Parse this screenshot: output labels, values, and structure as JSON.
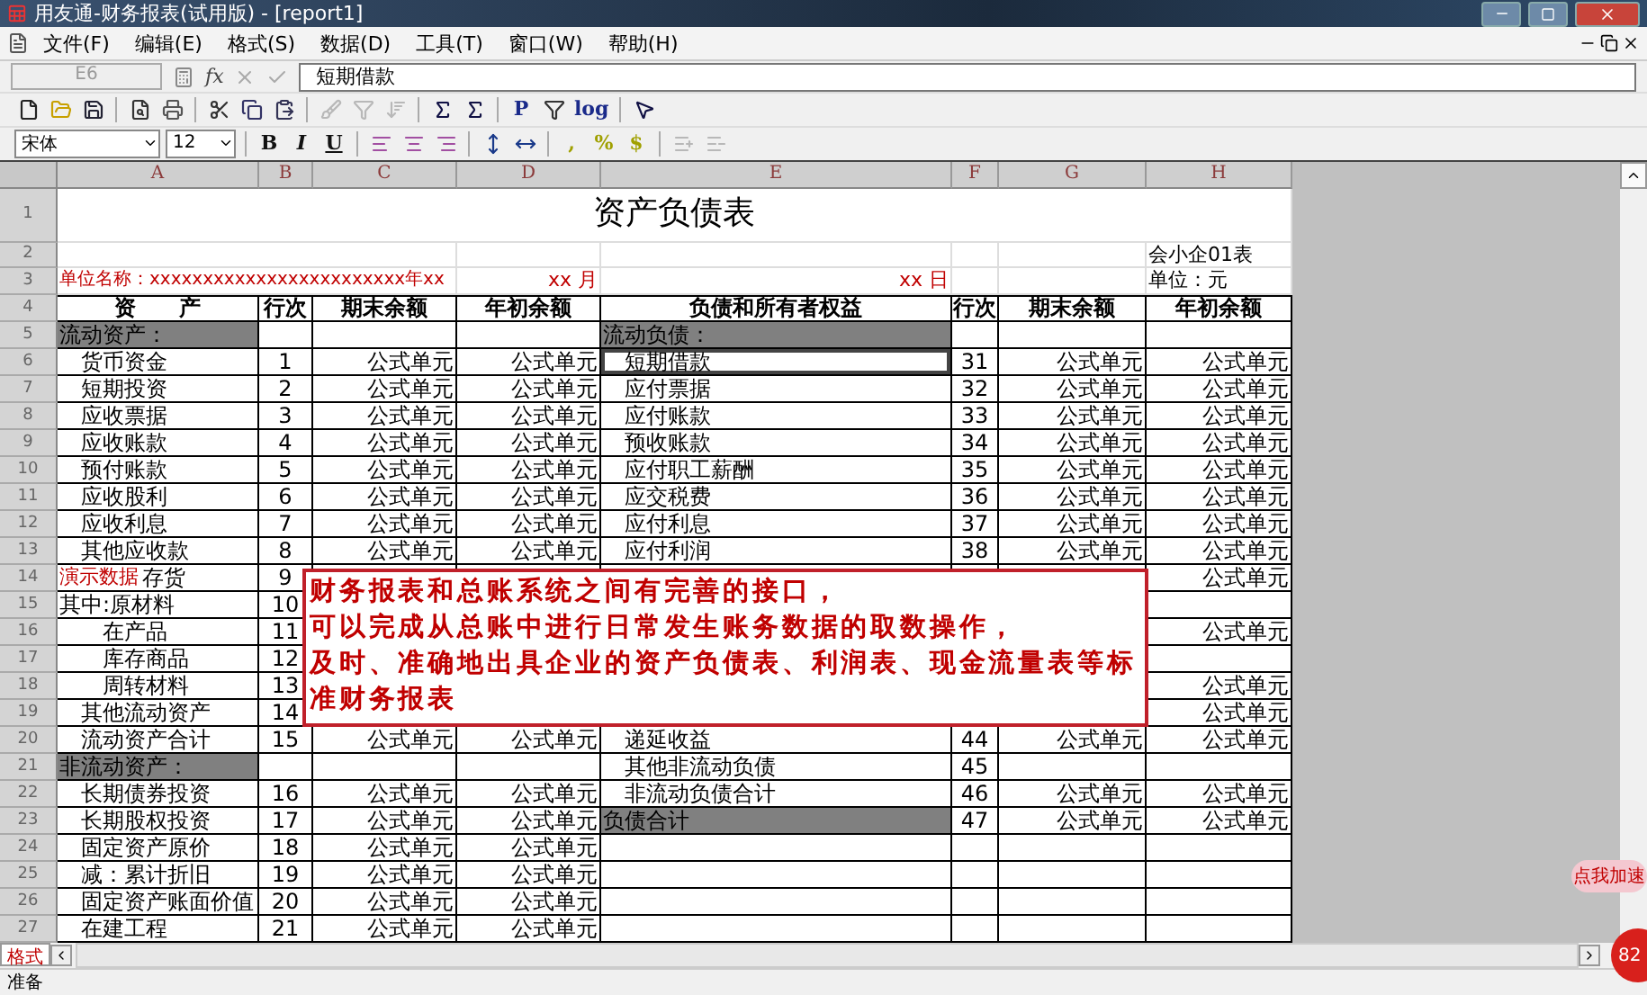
{
  "window": {
    "title": "用友通-财务报表(试用版) - [report1]"
  },
  "menu": [
    "文件(F)",
    "编辑(E)",
    "格式(S)",
    "数据(D)",
    "工具(T)",
    "窗口(W)",
    "帮助(H)"
  ],
  "formula_bar": {
    "cell": "E6",
    "fx": "fx",
    "content": "短期借款"
  },
  "toolbar": [
    {
      "kind": "icon",
      "disabled": false
    },
    {
      "kind": "icon",
      "disabled": false
    },
    {
      "kind": "icon",
      "disabled": false
    },
    {
      "kind": "separator"
    },
    {
      "kind": "icon",
      "disabled": false
    },
    {
      "kind": "icon",
      "disabled": false
    },
    {
      "kind": "separator"
    },
    {
      "kind": "icon",
      "disabled": false
    },
    {
      "kind": "icon",
      "disabled": false
    },
    {
      "kind": "icon",
      "disabled": false
    },
    {
      "kind": "separator"
    },
    {
      "kind": "icon",
      "disabled": true
    },
    {
      "kind": "icon",
      "disabled": true
    },
    {
      "kind": "icon",
      "disabled": true
    },
    {
      "kind": "separator"
    },
    {
      "kind": "icon",
      "disabled": false
    },
    {
      "kind": "icon",
      "disabled": false
    },
    {
      "kind": "separator"
    },
    {
      "kind": "text",
      "text": "P",
      "disabled": false
    },
    {
      "kind": "icon",
      "disabled": false
    },
    {
      "kind": "text",
      "text": "log",
      "disabled": false
    },
    {
      "kind": "separator"
    },
    {
      "kind": "icon",
      "disabled": false
    }
  ],
  "format_toolbar": {
    "font": "宋体",
    "size": "12",
    "items": [
      {
        "kind": "bold",
        "text": "B"
      },
      {
        "kind": "italic",
        "text": "I"
      },
      {
        "kind": "underline",
        "text": "U"
      },
      {
        "kind": "separator"
      },
      {
        "kind": "icon",
        "disabled": false
      },
      {
        "kind": "icon",
        "disabled": false
      },
      {
        "kind": "icon",
        "disabled": false
      },
      {
        "kind": "separator"
      },
      {
        "kind": "icon",
        "disabled": false
      },
      {
        "kind": "icon",
        "disabled": false
      },
      {
        "kind": "separator"
      },
      {
        "kind": "number-format",
        "text": ","
      },
      {
        "kind": "number-format",
        "text": "%"
      },
      {
        "kind": "number-format",
        "text": "$"
      },
      {
        "kind": "separator"
      },
      {
        "kind": "icon",
        "disabled": true
      },
      {
        "kind": "icon",
        "disabled": true
      }
    ]
  },
  "sheet": {
    "columns": [
      "A",
      "B",
      "C",
      "D",
      "E",
      "F",
      "G",
      "H"
    ],
    "rows": [
      {
        "number": "1",
        "kind": "title",
        "title": "资产负债表"
      },
      {
        "number": "2",
        "kind": "caption",
        "cells": {
          "h": {
            "text": "会小企01表",
            "color": "#000000"
          }
        }
      },
      {
        "number": "3",
        "kind": "caption",
        "cells": {
          "a": {
            "text": "单位名称：xxxxxxxxxxxxxxxxxxxxxxxx年xx",
            "color": "#c00000"
          },
          "d": {
            "text": "xx 月",
            "color": "#c00000"
          },
          "e": {
            "text": "xx 日",
            "color": "#c00000"
          },
          "h": {
            "text": "单位：元",
            "color": "#000000"
          }
        }
      },
      {
        "number": "4",
        "kind": "header",
        "cells": {
          "a": {
            "text": "资　　产"
          },
          "b": {
            "text": "行次"
          },
          "c": {
            "text": "期末余额"
          },
          "d": {
            "text": "年初余额"
          },
          "e": {
            "text": "负债和所有者权益"
          },
          "f": {
            "text": "行次"
          },
          "g": {
            "text": "期末余额"
          },
          "h": {
            "text": "年初余额"
          }
        }
      },
      {
        "number": "5",
        "kind": "data",
        "cells": {
          "a": {
            "text": "流动资产：",
            "shaded": true,
            "selected": false
          },
          "e": {
            "text": "流动负债：",
            "shaded": true,
            "selected": false
          }
        }
      },
      {
        "number": "6",
        "kind": "data",
        "cells": {
          "a": {
            "text": "　货币资金",
            "shaded": false,
            "selected": false
          },
          "b": {
            "text": "1",
            "shaded": false,
            "selected": false
          },
          "c": {
            "text": "公式单元",
            "shaded": false,
            "selected": false
          },
          "d": {
            "text": "公式单元",
            "shaded": false,
            "selected": false
          },
          "e": {
            "text": "　短期借款",
            "shaded": false,
            "selected": true
          },
          "f": {
            "text": "31",
            "shaded": false,
            "selected": false
          },
          "g": {
            "text": "公式单元",
            "shaded": false,
            "selected": false
          },
          "h": {
            "text": "公式单元",
            "shaded": false,
            "selected": false
          }
        }
      },
      {
        "number": "7",
        "kind": "data",
        "cells": {
          "a": {
            "text": "　短期投资",
            "shaded": false,
            "selected": false
          },
          "b": {
            "text": "2",
            "shaded": false,
            "selected": false
          },
          "c": {
            "text": "公式单元",
            "shaded": false,
            "selected": false
          },
          "d": {
            "text": "公式单元",
            "shaded": false,
            "selected": false
          },
          "e": {
            "text": "　应付票据",
            "shaded": false,
            "selected": false
          },
          "f": {
            "text": "32",
            "shaded": false,
            "selected": false
          },
          "g": {
            "text": "公式单元",
            "shaded": false,
            "selected": false
          },
          "h": {
            "text": "公式单元",
            "shaded": false,
            "selected": false
          }
        }
      },
      {
        "number": "8",
        "kind": "data",
        "cells": {
          "a": {
            "text": "　应收票据",
            "shaded": false,
            "selected": false
          },
          "b": {
            "text": "3",
            "shaded": false,
            "selected": false
          },
          "c": {
            "text": "公式单元",
            "shaded": false,
            "selected": false
          },
          "d": {
            "text": "公式单元",
            "shaded": false,
            "selected": false
          },
          "e": {
            "text": "　应付账款",
            "shaded": false,
            "selected": false
          },
          "f": {
            "text": "33",
            "shaded": false,
            "selected": false
          },
          "g": {
            "text": "公式单元",
            "shaded": false,
            "selected": false
          },
          "h": {
            "text": "公式单元",
            "shaded": false,
            "selected": false
          }
        }
      },
      {
        "number": "9",
        "kind": "data",
        "cells": {
          "a": {
            "text": "　应收账款",
            "shaded": false,
            "selected": false
          },
          "b": {
            "text": "4",
            "shaded": false,
            "selected": false
          },
          "c": {
            "text": "公式单元",
            "shaded": false,
            "selected": false
          },
          "d": {
            "text": "公式单元",
            "shaded": false,
            "selected": false
          },
          "e": {
            "text": "　预收账款",
            "shaded": false,
            "selected": false
          },
          "f": {
            "text": "34",
            "shaded": false,
            "selected": false
          },
          "g": {
            "text": "公式单元",
            "shaded": false,
            "selected": false
          },
          "h": {
            "text": "公式单元",
            "shaded": false,
            "selected": false
          }
        }
      },
      {
        "number": "10",
        "kind": "data",
        "cells": {
          "a": {
            "text": "　预付账款",
            "shaded": false,
            "selected": false
          },
          "b": {
            "text": "5",
            "shaded": false,
            "selected": false
          },
          "c": {
            "text": "公式单元",
            "shaded": false,
            "selected": false
          },
          "d": {
            "text": "公式单元",
            "shaded": false,
            "selected": false
          },
          "e": {
            "text": "　应付职工薪酬",
            "shaded": false,
            "selected": false
          },
          "f": {
            "text": "35",
            "shaded": false,
            "selected": false
          },
          "g": {
            "text": "公式单元",
            "shaded": false,
            "selected": false
          },
          "h": {
            "text": "公式单元",
            "shaded": false,
            "selected": false
          }
        }
      },
      {
        "number": "11",
        "kind": "data",
        "cells": {
          "a": {
            "text": "　应收股利",
            "shaded": false,
            "selected": false
          },
          "b": {
            "text": "6",
            "shaded": false,
            "selected": false
          },
          "c": {
            "text": "公式单元",
            "shaded": false,
            "selected": false
          },
          "d": {
            "text": "公式单元",
            "shaded": false,
            "selected": false
          },
          "e": {
            "text": "　应交税费",
            "shaded": false,
            "selected": false
          },
          "f": {
            "text": "36",
            "shaded": false,
            "selected": false
          },
          "g": {
            "text": "公式单元",
            "shaded": false,
            "selected": false
          },
          "h": {
            "text": "公式单元",
            "shaded": false,
            "selected": false
          }
        }
      },
      {
        "number": "12",
        "kind": "data",
        "cells": {
          "a": {
            "text": "　应收利息",
            "shaded": false,
            "selected": false
          },
          "b": {
            "text": "7",
            "shaded": false,
            "selected": false
          },
          "c": {
            "text": "公式单元",
            "shaded": false,
            "selected": false
          },
          "d": {
            "text": "公式单元",
            "shaded": false,
            "selected": false
          },
          "e": {
            "text": "　应付利息",
            "shaded": false,
            "selected": false
          },
          "f": {
            "text": "37",
            "shaded": false,
            "selected": false
          },
          "g": {
            "text": "公式单元",
            "shaded": false,
            "selected": false
          },
          "h": {
            "text": "公式单元",
            "shaded": false,
            "selected": false
          }
        }
      },
      {
        "number": "13",
        "kind": "data",
        "cells": {
          "a": {
            "text": "　其他应收款",
            "shaded": false,
            "selected": false
          },
          "b": {
            "text": "8",
            "shaded": false,
            "selected": false
          },
          "c": {
            "text": "公式单元",
            "shaded": false,
            "selected": false
          },
          "d": {
            "text": "公式单元",
            "shaded": false,
            "selected": false
          },
          "e": {
            "text": "　应付利润",
            "shaded": false,
            "selected": false
          },
          "f": {
            "text": "38",
            "shaded": false,
            "selected": false
          },
          "g": {
            "text": "公式单元",
            "shaded": false,
            "selected": false
          },
          "h": {
            "text": "公式单元",
            "shaded": false,
            "selected": false
          }
        }
      },
      {
        "number": "14",
        "kind": "data",
        "cells": {
          "a": {
            "text": "存货",
            "note": "演示数据",
            "shaded": false,
            "selected": false
          },
          "b": {
            "text": "9",
            "shaded": false,
            "selected": false
          },
          "h": {
            "text": "公式单元",
            "shaded": false,
            "selected": false
          }
        }
      },
      {
        "number": "15",
        "kind": "data",
        "cells": {
          "a": {
            "text": "其中:原材料",
            "shaded": false,
            "selected": false
          },
          "b": {
            "text": "10",
            "shaded": false,
            "selected": false
          }
        }
      },
      {
        "number": "16",
        "kind": "data",
        "cells": {
          "a": {
            "text": "　　在产品",
            "shaded": false,
            "selected": false
          },
          "b": {
            "text": "11",
            "shaded": false,
            "selected": false
          },
          "h": {
            "text": "公式单元",
            "shaded": false,
            "selected": false
          }
        }
      },
      {
        "number": "17",
        "kind": "data",
        "cells": {
          "a": {
            "text": "　　库存商品",
            "shaded": false,
            "selected": false
          },
          "b": {
            "text": "12",
            "shaded": false,
            "selected": false
          }
        }
      },
      {
        "number": "18",
        "kind": "data",
        "cells": {
          "a": {
            "text": "　　周转材料",
            "shaded": false,
            "selected": false
          },
          "b": {
            "text": "13",
            "shaded": false,
            "selected": false
          },
          "h": {
            "text": "公式单元",
            "shaded": false,
            "selected": false
          }
        }
      },
      {
        "number": "19",
        "kind": "data",
        "cells": {
          "a": {
            "text": "　其他流动资产",
            "shaded": false,
            "selected": false
          },
          "b": {
            "text": "14",
            "shaded": false,
            "selected": false
          },
          "h": {
            "text": "公式单元",
            "shaded": false,
            "selected": false
          }
        }
      },
      {
        "number": "20",
        "kind": "data",
        "cells": {
          "a": {
            "text": "　流动资产合计",
            "shaded": false,
            "selected": false
          },
          "b": {
            "text": "15",
            "shaded": false,
            "selected": false
          },
          "c": {
            "text": "公式单元",
            "shaded": false,
            "selected": false
          },
          "d": {
            "text": "公式单元",
            "shaded": false,
            "selected": false
          },
          "e": {
            "text": "　递延收益",
            "shaded": false,
            "selected": false
          },
          "f": {
            "text": "44",
            "shaded": false,
            "selected": false
          },
          "g": {
            "text": "公式单元",
            "shaded": false,
            "selected": false
          },
          "h": {
            "text": "公式单元",
            "shaded": false,
            "selected": false
          }
        }
      },
      {
        "number": "21",
        "kind": "data",
        "cells": {
          "a": {
            "text": "非流动资产：",
            "shaded": true,
            "selected": false
          },
          "e": {
            "text": "　其他非流动负债",
            "shaded": false,
            "selected": false
          },
          "f": {
            "text": "45",
            "shaded": false,
            "selected": false
          }
        }
      },
      {
        "number": "22",
        "kind": "data",
        "cells": {
          "a": {
            "text": "　长期债券投资",
            "shaded": false,
            "selected": false
          },
          "b": {
            "text": "16",
            "shaded": false,
            "selected": false
          },
          "c": {
            "text": "公式单元",
            "shaded": false,
            "selected": false
          },
          "d": {
            "text": "公式单元",
            "shaded": false,
            "selected": false
          },
          "e": {
            "text": "　非流动负债合计",
            "shaded": false,
            "selected": false
          },
          "f": {
            "text": "46",
            "shaded": false,
            "selected": false
          },
          "g": {
            "text": "公式单元",
            "shaded": false,
            "selected": false
          },
          "h": {
            "text": "公式单元",
            "shaded": false,
            "selected": false
          }
        }
      },
      {
        "number": "23",
        "kind": "data",
        "cells": {
          "a": {
            "text": "　长期股权投资",
            "shaded": false,
            "selected": false
          },
          "b": {
            "text": "17",
            "shaded": false,
            "selected": false
          },
          "c": {
            "text": "公式单元",
            "shaded": false,
            "selected": false
          },
          "d": {
            "text": "公式单元",
            "shaded": false,
            "selected": false
          },
          "e": {
            "text": "负债合计",
            "shaded": true,
            "selected": false
          },
          "f": {
            "text": "47",
            "shaded": false,
            "selected": false
          },
          "g": {
            "text": "公式单元",
            "shaded": false,
            "selected": false
          },
          "h": {
            "text": "公式单元",
            "shaded": false,
            "selected": false
          }
        }
      },
      {
        "number": "24",
        "kind": "data",
        "cells": {
          "a": {
            "text": "　固定资产原价",
            "shaded": false,
            "selected": false
          },
          "b": {
            "text": "18",
            "shaded": false,
            "selected": false
          },
          "c": {
            "text": "公式单元",
            "shaded": false,
            "selected": false
          },
          "d": {
            "text": "公式单元",
            "shaded": false,
            "selected": false
          }
        }
      },
      {
        "number": "25",
        "kind": "data",
        "cells": {
          "a": {
            "text": "　减：累计折旧",
            "shaded": false,
            "selected": false
          },
          "b": {
            "text": "19",
            "shaded": false,
            "selected": false
          },
          "c": {
            "text": "公式单元",
            "shaded": false,
            "selected": false
          },
          "d": {
            "text": "公式单元",
            "shaded": false,
            "selected": false
          }
        }
      },
      {
        "number": "26",
        "kind": "data",
        "cells": {
          "a": {
            "text": "　固定资产账面价值",
            "shaded": false,
            "selected": false
          },
          "b": {
            "text": "20",
            "shaded": false,
            "selected": false
          },
          "c": {
            "text": "公式单元",
            "shaded": false,
            "selected": false
          },
          "d": {
            "text": "公式单元",
            "shaded": false,
            "selected": false
          }
        }
      },
      {
        "number": "27",
        "kind": "data",
        "cells": {
          "a": {
            "text": "　在建工程",
            "shaded": false,
            "selected": false
          },
          "b": {
            "text": "21",
            "shaded": false,
            "selected": false
          },
          "c": {
            "text": "公式单元",
            "shaded": false,
            "selected": false
          },
          "d": {
            "text": "公式单元",
            "shaded": false,
            "selected": false
          }
        }
      }
    ]
  },
  "callout": {
    "lines": [
      "财务报表和总账系统之间有完善的接口，",
      "可以完成从总账中进行日常发生账务数据的取数操作，",
      "及时、准确地出具企业的资产负债表、利润表、现金流量表等标准财务报表"
    ]
  },
  "sheet_tabs": [
    {
      "label": "格式",
      "selected": true
    }
  ],
  "status_bar": {
    "text": "准备"
  },
  "floating_widget": {
    "label": "点我加速",
    "count": "82"
  }
}
